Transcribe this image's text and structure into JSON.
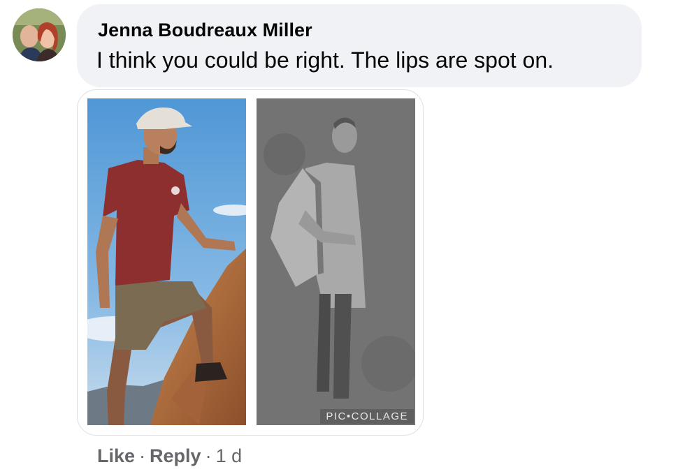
{
  "comment": {
    "author": "Jenna Boudreaux Miller",
    "text": "I think you could be right. The lips are spot on.",
    "attachment": {
      "watermark": "PIC•COLLAGE"
    },
    "actions": {
      "like": "Like",
      "reply": "Reply",
      "separator": "·",
      "timestamp": "1 d"
    }
  },
  "colors": {
    "bubble": "#f0f2f5",
    "name": "#050505",
    "meta": "#65676b"
  }
}
